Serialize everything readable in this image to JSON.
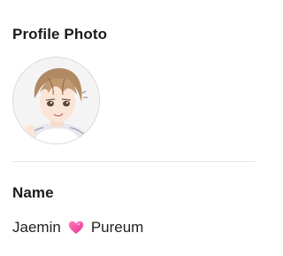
{
  "profile_photo": {
    "title": "Profile Photo",
    "avatar_icon": "anime-avatar"
  },
  "name_section": {
    "title": "Name",
    "first_name": "Jaemin",
    "heart_icon": "pink-heart-emoji",
    "second_name": "Pureum"
  },
  "colors": {
    "heart": "#ff4fa3",
    "text": "#1b1b1b",
    "divider": "#e6e6e6"
  }
}
